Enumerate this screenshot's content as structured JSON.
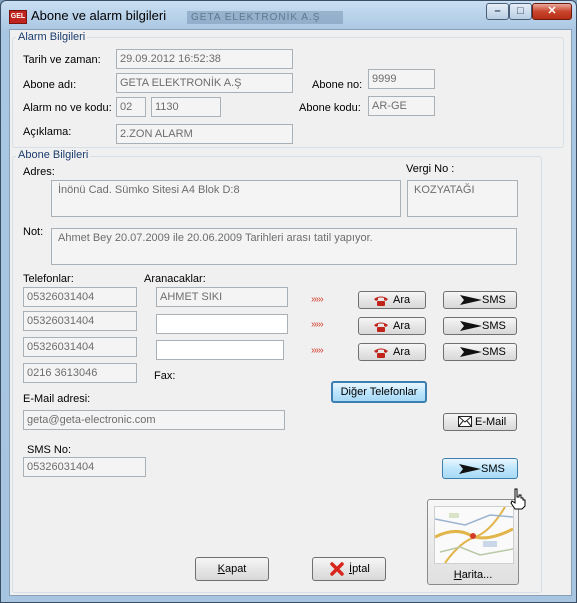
{
  "window": {
    "title": "Abone ve alarm bilgileri",
    "ghost_title": "GETA ELEKTRONİK A.Ş",
    "icon_text": "GEL",
    "min_glyph": "–",
    "max_glyph": "□",
    "close_glyph": "✕"
  },
  "alarm": {
    "legend": "Alarm Bilgileri",
    "datetime_label": "Tarih ve zaman:",
    "datetime_value": "29.09.2012 16:52:38",
    "subscriber_name_label": "Abone adı:",
    "subscriber_name_value": "GETA ELEKTRONİK A.Ş",
    "subscriber_no_label": "Abone no:",
    "subscriber_no_value": "9999",
    "alarm_label": "Alarm no ve kodu:",
    "alarm_no_value": "02",
    "alarm_code_value": "1130",
    "subscriber_code_label": "Abone kodu:",
    "subscriber_code_value": "AR-GE",
    "description_label": "Açıklama:",
    "description_value": "2.ZON ALARM"
  },
  "subscriber": {
    "legend": "Abone Bilgileri",
    "address_label": "Adres:",
    "address_value": "İnönü Cad. Sümko Sitesi A4 Blok D:8",
    "tax_label": "Vergi No :",
    "tax_value": "KOZYATAĞI",
    "note_label": "Not:",
    "note_value": "Ahmet Bey 20.07.2009 ile 20.06.2009 Tarihleri  arası tatil yapıyor.",
    "phones_label": "Telefonlar:",
    "callees_label": "Aranacaklar:",
    "fax_label": "Fax:",
    "arrows": "›››››",
    "call_label": "Ara",
    "sms_label": "SMS",
    "rows": [
      {
        "phone": "05326031404",
        "callee": "AHMET SIKI"
      },
      {
        "phone": "05326031404",
        "callee": ""
      },
      {
        "phone": "05326031404",
        "callee": ""
      }
    ],
    "fax_phone": "0216 3613046",
    "other_phones_label": "Diğer  Telefonlar",
    "email_label": "E-Mail adresi:",
    "email_value": "geta@geta-electronic.com",
    "email_button": "E-Mail",
    "sms_no_label": "SMS No:",
    "sms_no_value": "05326031404",
    "sms_send_label": "SMS",
    "map_label": "Harita...",
    "close_label": "Kapat",
    "cancel_label": "İptal"
  },
  "colors": {
    "legend_text": "#1b3c6e",
    "arrow_red": "#d23a2a",
    "cancel_x": "#d8261c"
  },
  "icons": [
    "app-icon",
    "phone-icon",
    "sms-arrow-icon",
    "envelope-icon",
    "cancel-x-icon",
    "map-thumbnail",
    "hand-cursor-icon"
  ]
}
